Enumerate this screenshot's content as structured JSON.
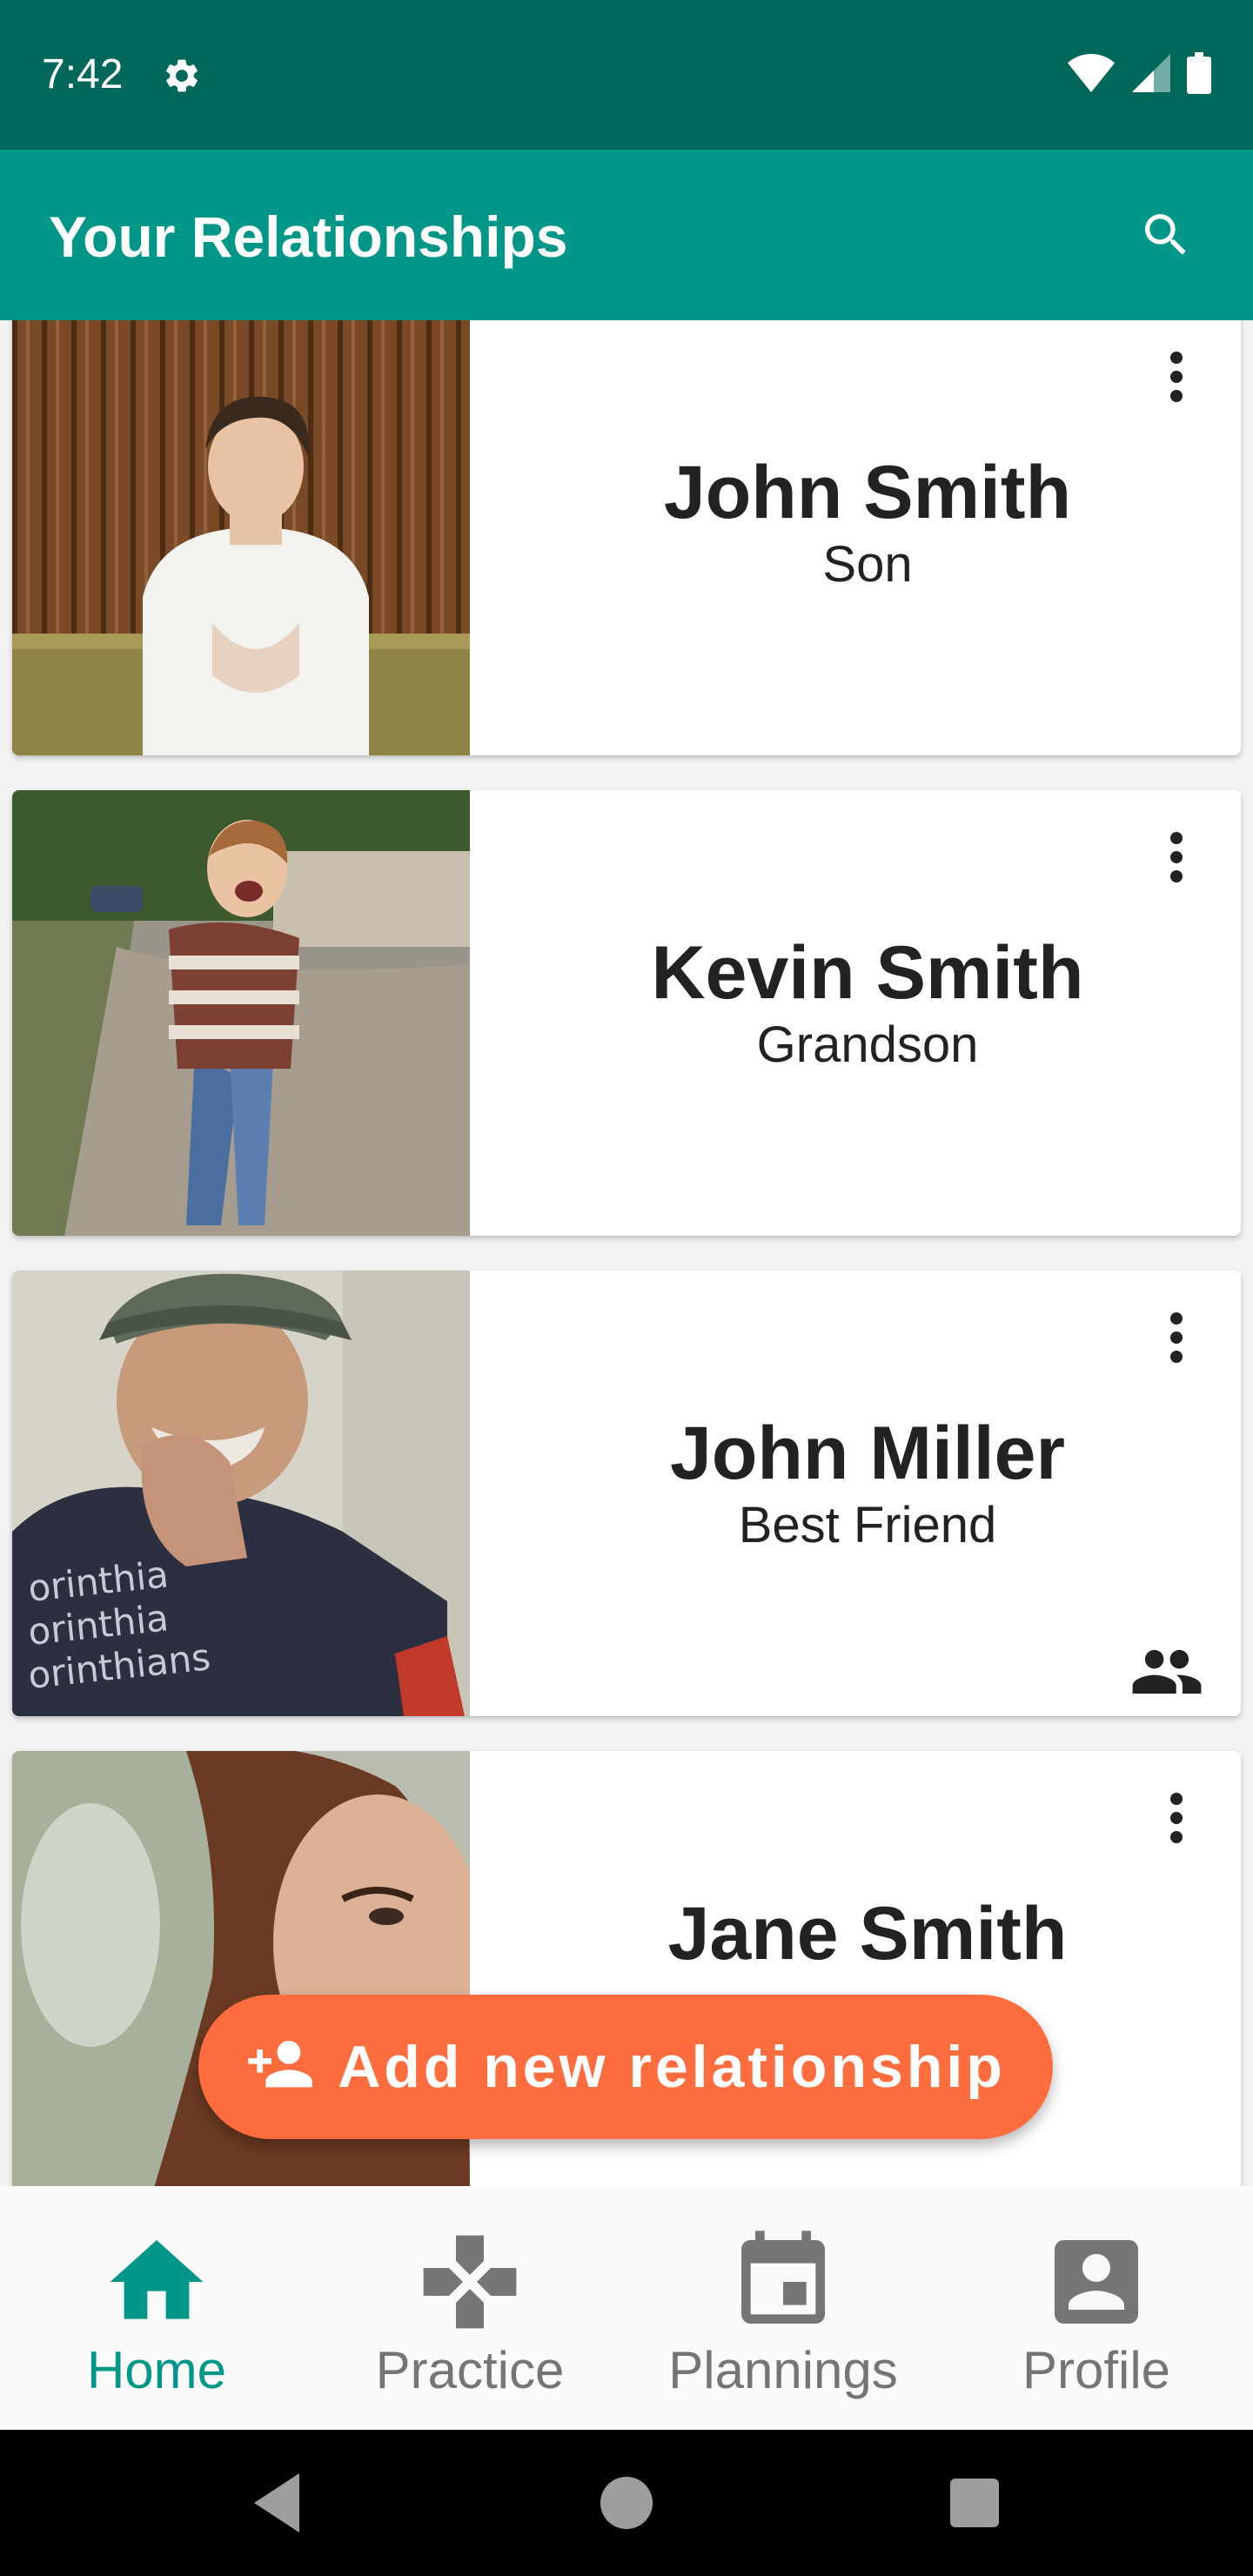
{
  "status_bar": {
    "time": "7:42",
    "icons": [
      "gear-icon",
      "wifi-icon",
      "cell-signal-icon",
      "battery-icon"
    ]
  },
  "app_bar": {
    "title": "Your Relationships",
    "search_icon": "search-icon"
  },
  "relationships": [
    {
      "name": "John Smith",
      "relation": "Son",
      "shared": false,
      "photo": "young-man-photo"
    },
    {
      "name": "Kevin Smith",
      "relation": "Grandson",
      "shared": false,
      "photo": "child-running-photo"
    },
    {
      "name": "John Miller",
      "relation": "Best Friend",
      "shared": true,
      "photo": "elderly-man-photo"
    },
    {
      "name": "Jane Smith",
      "relation": "",
      "shared": false,
      "photo": "woman-photo"
    }
  ],
  "fab": {
    "label": "Add new relationship",
    "icon": "person-add-icon"
  },
  "bottom_nav": {
    "items": [
      {
        "label": "Home",
        "icon": "home-icon",
        "active": true
      },
      {
        "label": "Practice",
        "icon": "gamepad-icon",
        "active": false
      },
      {
        "label": "Plannings",
        "icon": "calendar-icon",
        "active": false
      },
      {
        "label": "Profile",
        "icon": "account-box-icon",
        "active": false
      }
    ]
  },
  "colors": {
    "status_bar": "#00675b",
    "app_bar": "#009688",
    "accent": "#ff6d3f",
    "active_nav": "#009688",
    "inactive_nav": "#757575"
  }
}
